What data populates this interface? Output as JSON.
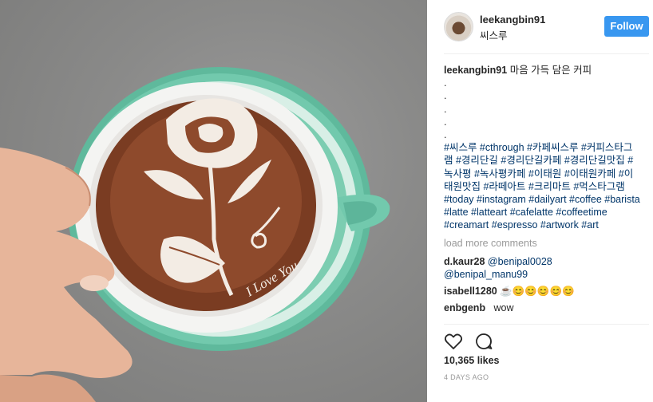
{
  "post": {
    "username": "leekangbin91",
    "location": "씨스루",
    "follow_label": "Follow",
    "caption_user": "leekangbin91",
    "caption_text": "마음 가득 담은 커피",
    "caption_dots": [
      ".",
      ".",
      ".",
      ".",
      "."
    ],
    "hashtags": "#씨스루 #cthrough #카페씨스루 #커피스타그램 #경리단길 #경리단길카페 #경리단길맛집 #녹사평 #녹사평카페 #이태원 #이태원카페 #이태원맛집 #라떼아트 #크리마트 #먹스타그램 #today #instagram #dailyart #coffee #barista #latte #latteart #cafelatte #coffeetime #creamart #espresso #artwork #art",
    "load_more": "load more comments",
    "comments": [
      {
        "user": "d.kaur28",
        "mention1": "@benipal0028",
        "mention2": "@benipal_manu99"
      },
      {
        "user": "isabell1280",
        "text": "☕😊😊😊😊😊"
      },
      {
        "user": "enbgenb",
        "text": "wow"
      }
    ],
    "likes": "10,365 likes",
    "time": "4 DAYS AGO"
  },
  "latte_art_text": "I Love You",
  "icons": {
    "like": "heart-icon",
    "comment": "comment-bubble-icon"
  },
  "colors": {
    "accent": "#3897f0",
    "hashtag": "#003569",
    "muted": "#999999",
    "cup": "#6fc5aa"
  }
}
